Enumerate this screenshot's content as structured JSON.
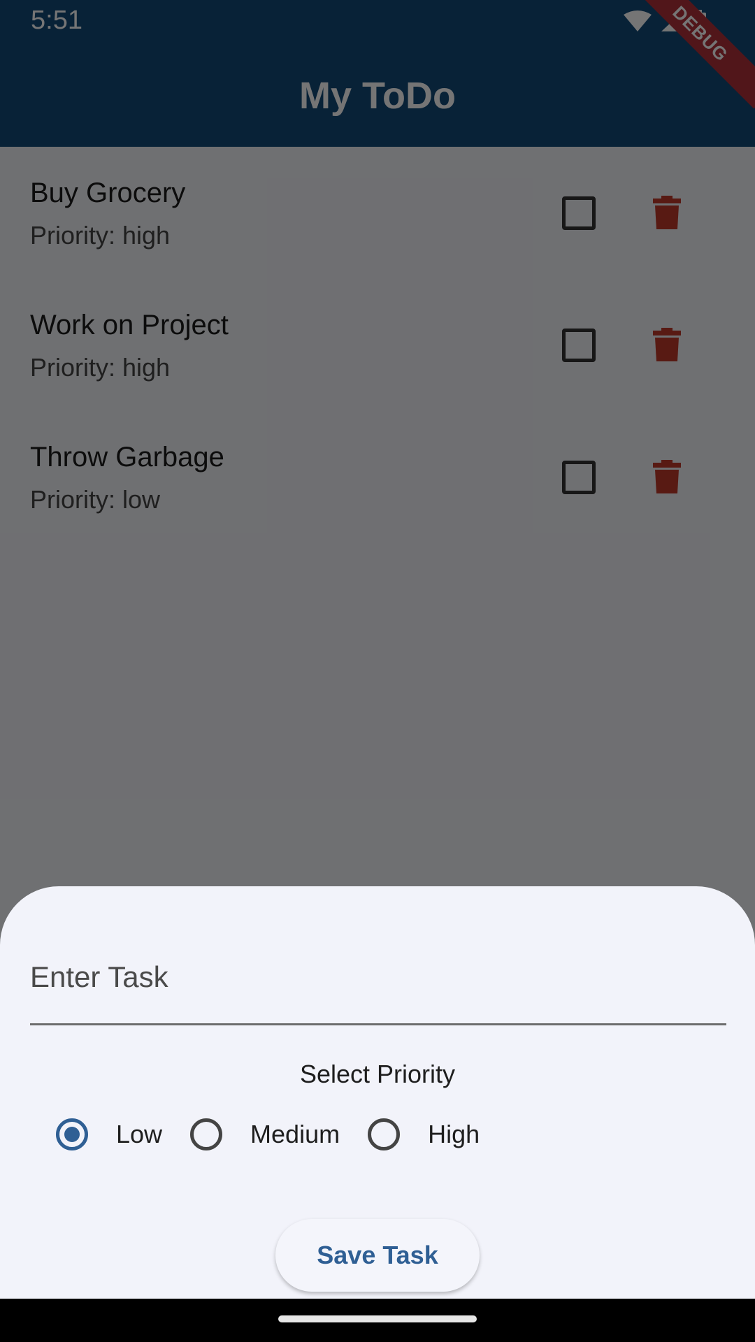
{
  "status_bar": {
    "time": "5:51"
  },
  "app_bar": {
    "title": "My ToDo"
  },
  "debug_banner": "DEBUG",
  "tasks": [
    {
      "title": "Buy Grocery",
      "priority": "Priority: high",
      "done": false
    },
    {
      "title": "Work on Project",
      "priority": "Priority: high",
      "done": false
    },
    {
      "title": "Throw Garbage",
      "priority": "Priority: low",
      "done": false
    }
  ],
  "sheet": {
    "task_input": {
      "placeholder": "Enter Task",
      "value": ""
    },
    "priority_label": "Select Priority",
    "priority_options": [
      {
        "label": "Low",
        "selected": true
      },
      {
        "label": "Medium",
        "selected": false
      },
      {
        "label": "High",
        "selected": false
      }
    ],
    "save_label": "Save Task"
  },
  "colors": {
    "app_bar": "#124a78",
    "accent": "#2f5f94",
    "delete": "#c0392b",
    "scrim": "rgba(0,0,0,0.54)"
  },
  "icons": {
    "status": [
      "wifi-icon",
      "signal-icon",
      "battery-icon"
    ],
    "delete": "trash-icon"
  }
}
